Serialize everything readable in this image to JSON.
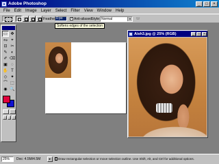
{
  "window": {
    "title": "Adobe Photoshop",
    "min": "_",
    "max": "□",
    "close": "×"
  },
  "menu": [
    "File",
    "Edit",
    "Image",
    "Layer",
    "Select",
    "Filter",
    "View",
    "Window",
    "Help"
  ],
  "options": {
    "feather_label": "Feather:",
    "feather_value": "0 px",
    "antialias_checked": "✓",
    "antialias_label": "Anti-aliased",
    "style_label": "Style:",
    "style_value": "Normal",
    "width_label": "W",
    "tooltip": "Softens edges of the selection"
  },
  "toolbox": {
    "tools": [
      "▭",
      "✥",
      "ᔓ",
      "⌖",
      "⊡",
      "✂",
      "✎",
      "◐",
      "✐",
      "⌫",
      "▣",
      "◌",
      "✋",
      "T",
      "◇",
      "✦",
      "⌒",
      "⬚",
      "◉",
      "🔍"
    ],
    "foreground_color": "#e0003c",
    "background_color": "#1010d0"
  },
  "document": {
    "title": "Aish3.jpg @ 25% (RGB)",
    "min": "_",
    "max": "□",
    "close": "×"
  },
  "status": {
    "zoom": "25%",
    "doc_size": "Doc: 4.5M/4.5M",
    "arrow": "▸",
    "hint": "Draw rectangular selection or move selection outline. Use Shift, Alt, and Ctrl for additional options."
  }
}
